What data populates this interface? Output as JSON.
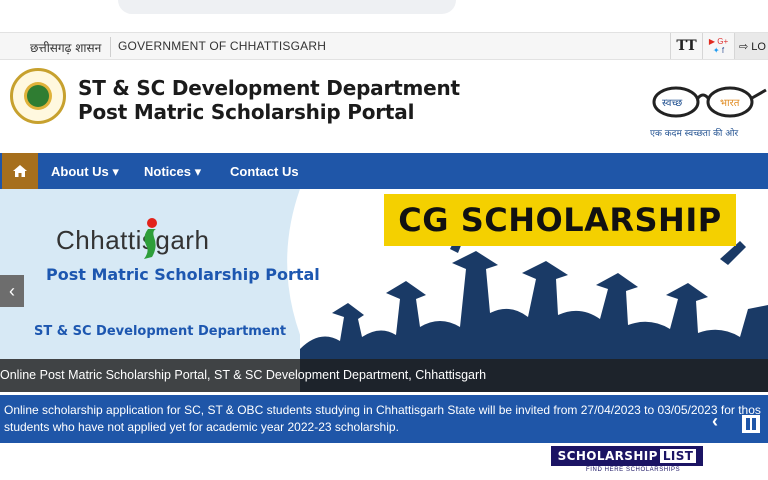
{
  "top_bar": {
    "hindi_label": "छत्तीसगढ़ शासन",
    "gov_label": "GOVERNMENT OF CHHATTISGARH",
    "font_tool_label": "TT",
    "login_label": "⇨ LO"
  },
  "header": {
    "title_line1": "ST & SC Development Department",
    "title_line2": "Post Matric Scholarship Portal",
    "swachh_text_left": "स्वच्छ",
    "swachh_text_right": "भारत",
    "swachh_caption": "एक कदम स्वच्छता की ओर"
  },
  "nav": {
    "home_icon": "home-icon",
    "items": [
      {
        "label": "About Us ▾"
      },
      {
        "label": "Notices ▾"
      },
      {
        "label": "Contact Us"
      }
    ]
  },
  "banner": {
    "state_name": "Chhattisgarh",
    "portal_name": "Post Matric Scholarship Portal",
    "department": "ST & SC Development Department",
    "badge": "CG SCHOLARSHIP",
    "caption": "Online Post Matric Scholarship Portal, ST & SC Development Department, Chhattisgarh"
  },
  "notice": {
    "line1": "Online scholarship application for SC, ST & OBC students studying in Chhattisgarh State will be invited from 27/04/2023 to 03/05/2023 for thos",
    "line2": "students who have not applied yet for academic year 2022-23 scholarship."
  },
  "watermark": {
    "part1": "SCHOLARSHIP",
    "part2": "LIST",
    "subtitle": "FIND HERE SCHOLARSHIPS"
  },
  "colors": {
    "nav_blue": "#1f56a8",
    "home_brown": "#a66f1d",
    "badge_yellow": "#f4d000",
    "crowd_navy": "#1a3a66"
  }
}
